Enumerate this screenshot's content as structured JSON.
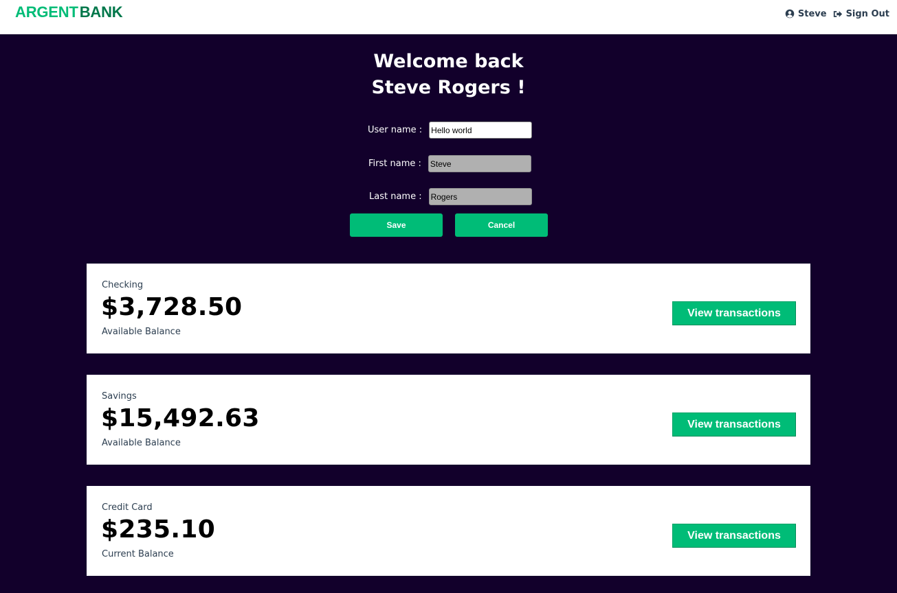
{
  "header": {
    "logo_part1": "ARGENT",
    "logo_part2": "BANK",
    "user_label": "Steve",
    "signout_label": "Sign Out",
    "user_icon": "user-circle-icon",
    "signout_icon": "sign-out-icon"
  },
  "welcome": {
    "line1": "Welcome back",
    "line2": "Steve Rogers !"
  },
  "form": {
    "username_label": "User name :",
    "username_value": "Hello world",
    "firstname_label": "First name :",
    "firstname_value": "Steve",
    "lastname_label": "Last name :",
    "lastname_value": "Rogers",
    "save_label": "Save",
    "cancel_label": "Cancel"
  },
  "accounts": [
    {
      "title": "Checking",
      "amount": "$3,728.50",
      "description": "Available Balance",
      "button": "View transactions"
    },
    {
      "title": "Savings",
      "amount": "$15,492.63",
      "description": "Available Balance",
      "button": "View transactions"
    },
    {
      "title": "Credit Card",
      "amount": "$235.10",
      "description": "Current Balance",
      "button": "View transactions"
    }
  ],
  "colors": {
    "background": "#12002b",
    "accent": "#00bc77",
    "logo_dark": "#00774a"
  }
}
